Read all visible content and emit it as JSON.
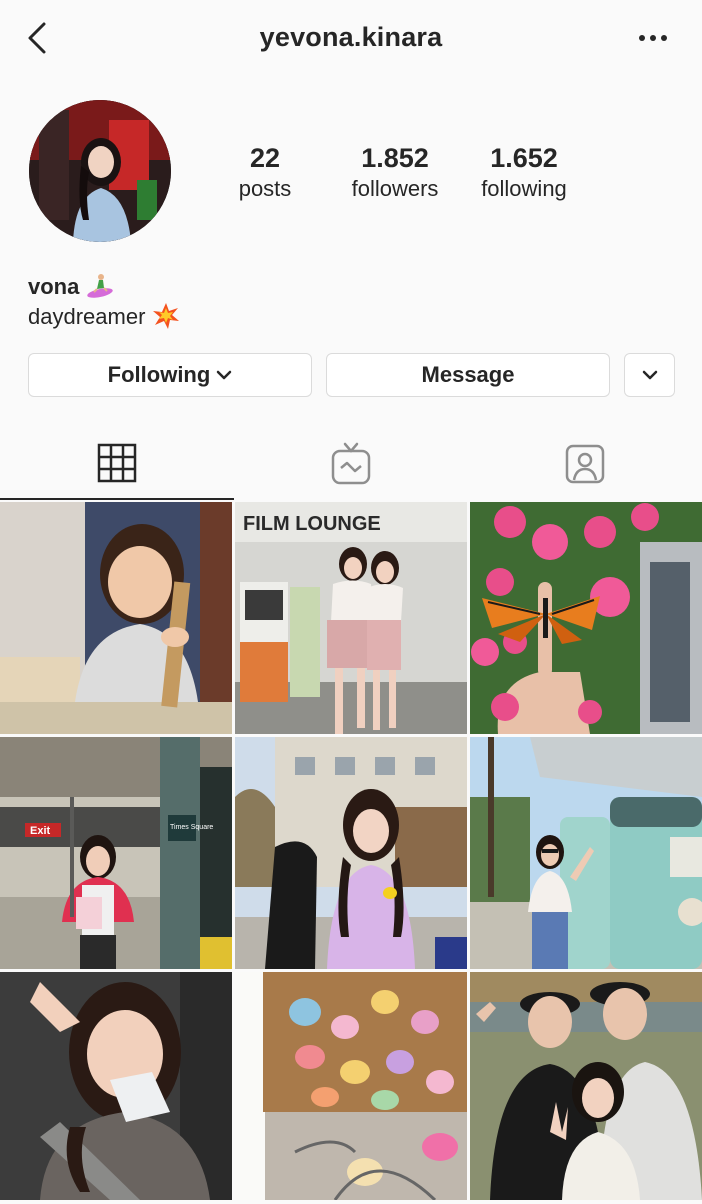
{
  "header": {
    "username": "yevona.kinara",
    "back_icon": "chevron-left-icon",
    "more_icon": "more-horizontal-icon"
  },
  "profile": {
    "stats": [
      {
        "value": "22",
        "label": "posts"
      },
      {
        "value": "1.852",
        "label": "followers"
      },
      {
        "value": "1.652",
        "label": "following"
      }
    ],
    "name": "vona",
    "bio": "daydreamer"
  },
  "actions": {
    "following_label": "Following",
    "message_label": "Message"
  },
  "tabs": [
    "grid-icon",
    "igtv-icon",
    "tagged-icon"
  ],
  "grid": {
    "posts": [
      {
        "label": "childhood photo"
      },
      {
        "label": "FILM LOUNGE"
      },
      {
        "label": "butterfly flowers"
      },
      {
        "label": "Exit"
      },
      {
        "label": "campus"
      },
      {
        "label": "gas pump"
      },
      {
        "label": "car selfie"
      },
      {
        "label": "cookies"
      },
      {
        "label": "group selfie"
      }
    ],
    "film_lounge_sign": "FILM LOUNGE",
    "exit_sign": "Exit",
    "station_sign": "Times Square"
  },
  "colors": {
    "text": "#262626",
    "border": "#dbdbdb",
    "background": "#fafafa"
  }
}
